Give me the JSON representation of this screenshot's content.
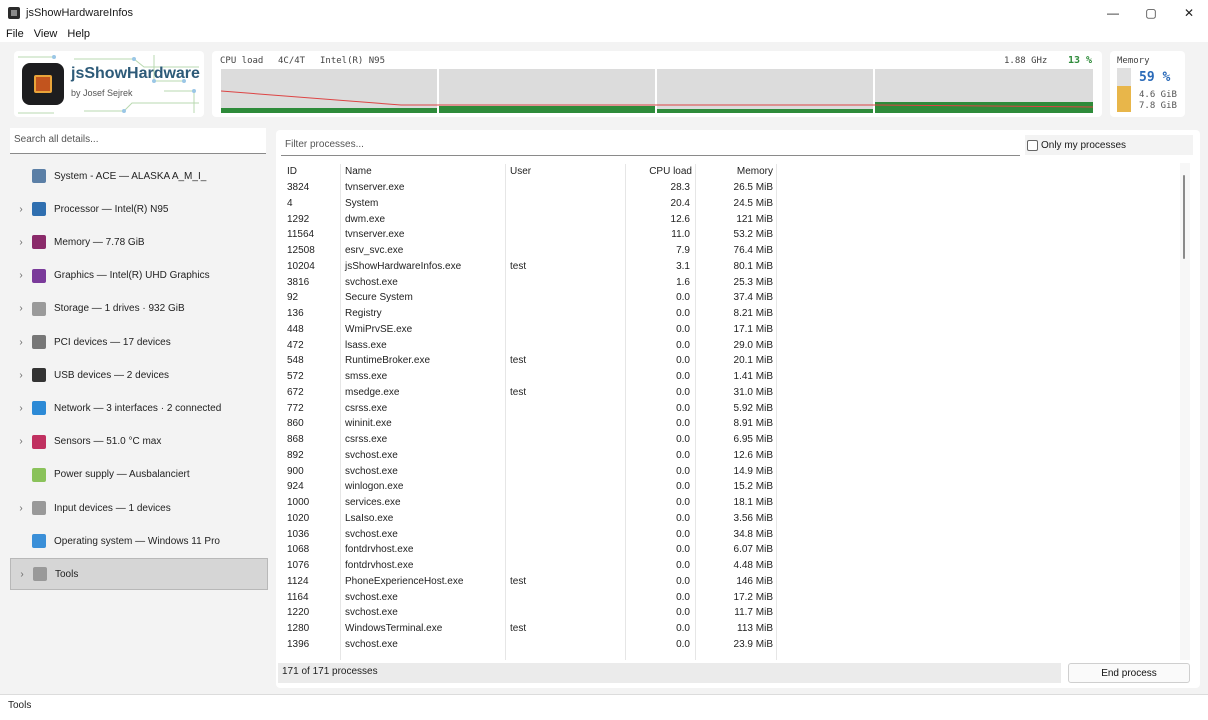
{
  "window": {
    "title": "jsShowHardwareInfos",
    "minimize": "—",
    "maximize": "▢",
    "close": "✕"
  },
  "menu": [
    "File",
    "View",
    "Help"
  ],
  "brand": {
    "name": "jsShowHardware",
    "author": "by Josef Sejrek"
  },
  "cpu": {
    "label": "CPU load",
    "cores": "4C/4T",
    "model": "Intel(R) N95",
    "freq": "1.88 GHz",
    "load": "13 %",
    "load_value": 13,
    "accent": "#2e8b3a"
  },
  "memory": {
    "title": "Memory",
    "percent": "59 %",
    "percent_value": 59,
    "used": "4.6 GiB",
    "total": "7.8 GiB",
    "accent": "#e8b64a"
  },
  "sidebar": {
    "search_placeholder": "Search all details...",
    "items": [
      {
        "label": "System - ACE  —  ALASKA A_M_I_",
        "icon": "system-icon",
        "expandable": false
      },
      {
        "label": "Processor  —  Intel(R) N95",
        "icon": "cpu-icon",
        "expandable": true
      },
      {
        "label": "Memory  —  7.78 GiB",
        "icon": "memory-icon",
        "expandable": true
      },
      {
        "label": "Graphics  —  Intel(R) UHD Graphics",
        "icon": "gamepad-icon",
        "expandable": true
      },
      {
        "label": "Storage  —  1 drives · 932 GiB",
        "icon": "disk-icon",
        "expandable": true
      },
      {
        "label": "PCI devices  —  17 devices",
        "icon": "pci-icon",
        "expandable": true
      },
      {
        "label": "USB devices  —  2 devices",
        "icon": "usb-icon",
        "expandable": true
      },
      {
        "label": "Network  —  3 interfaces · 2 connected",
        "icon": "globe-icon",
        "expandable": true
      },
      {
        "label": "Sensors  —  51.0 °C max",
        "icon": "thermometer-icon",
        "expandable": true
      },
      {
        "label": "Power supply  —  Ausbalanciert",
        "icon": "battery-icon",
        "expandable": false
      },
      {
        "label": "Input devices  —  1 devices",
        "icon": "keyboard-icon",
        "expandable": true
      },
      {
        "label": "Operating system  —  Windows 11 Pro",
        "icon": "os-icon",
        "expandable": false
      },
      {
        "label": "Tools",
        "icon": "tools-icon",
        "expandable": true,
        "active": true
      }
    ]
  },
  "processes": {
    "filter_placeholder": "Filter processes...",
    "only_mine_label": "Only my processes",
    "columns": [
      "ID",
      "Name",
      "User",
      "CPU load",
      "Memory"
    ],
    "rows": [
      [
        "3824",
        "tvnserver.exe",
        "",
        "28.3",
        "26.5 MiB"
      ],
      [
        "4",
        "System",
        "",
        "20.4",
        "24.5 MiB"
      ],
      [
        "1292",
        "dwm.exe",
        "",
        "12.6",
        "121 MiB"
      ],
      [
        "11564",
        "tvnserver.exe",
        "",
        "11.0",
        "53.2 MiB"
      ],
      [
        "12508",
        "esrv_svc.exe",
        "",
        "7.9",
        "76.4 MiB"
      ],
      [
        "10204",
        "jsShowHardwareInfos.exe",
        "test",
        "3.1",
        "80.1 MiB"
      ],
      [
        "3816",
        "svchost.exe",
        "",
        "1.6",
        "25.3 MiB"
      ],
      [
        "92",
        "Secure System",
        "",
        "0.0",
        "37.4 MiB"
      ],
      [
        "136",
        "Registry",
        "",
        "0.0",
        "8.21 MiB"
      ],
      [
        "448",
        "WmiPrvSE.exe",
        "",
        "0.0",
        "17.1 MiB"
      ],
      [
        "472",
        "lsass.exe",
        "",
        "0.0",
        "29.0 MiB"
      ],
      [
        "548",
        "RuntimeBroker.exe",
        "test",
        "0.0",
        "20.1 MiB"
      ],
      [
        "572",
        "smss.exe",
        "",
        "0.0",
        "1.41 MiB"
      ],
      [
        "672",
        "msedge.exe",
        "test",
        "0.0",
        "31.0 MiB"
      ],
      [
        "772",
        "csrss.exe",
        "",
        "0.0",
        "5.92 MiB"
      ],
      [
        "860",
        "wininit.exe",
        "",
        "0.0",
        "8.91 MiB"
      ],
      [
        "868",
        "csrss.exe",
        "",
        "0.0",
        "6.95 MiB"
      ],
      [
        "892",
        "svchost.exe",
        "",
        "0.0",
        "12.6 MiB"
      ],
      [
        "900",
        "svchost.exe",
        "",
        "0.0",
        "14.9 MiB"
      ],
      [
        "924",
        "winlogon.exe",
        "",
        "0.0",
        "15.2 MiB"
      ],
      [
        "1000",
        "services.exe",
        "",
        "0.0",
        "18.1 MiB"
      ],
      [
        "1020",
        "LsaIso.exe",
        "",
        "0.0",
        "3.56 MiB"
      ],
      [
        "1036",
        "svchost.exe",
        "",
        "0.0",
        "34.8 MiB"
      ],
      [
        "1068",
        "fontdrvhost.exe",
        "",
        "0.0",
        "6.07 MiB"
      ],
      [
        "1076",
        "fontdrvhost.exe",
        "",
        "0.0",
        "4.48 MiB"
      ],
      [
        "1124",
        "PhoneExperienceHost.exe",
        "test",
        "0.0",
        "146 MiB"
      ],
      [
        "1164",
        "svchost.exe",
        "",
        "0.0",
        "17.2 MiB"
      ],
      [
        "1220",
        "svchost.exe",
        "",
        "0.0",
        "11.7 MiB"
      ],
      [
        "1280",
        "WindowsTerminal.exe",
        "test",
        "0.0",
        "113 MiB"
      ],
      [
        "1396",
        "svchost.exe",
        "",
        "0.0",
        "23.9 MiB"
      ]
    ],
    "count": "171 of 171 processes",
    "end_button": "End process"
  },
  "status": "Tools"
}
